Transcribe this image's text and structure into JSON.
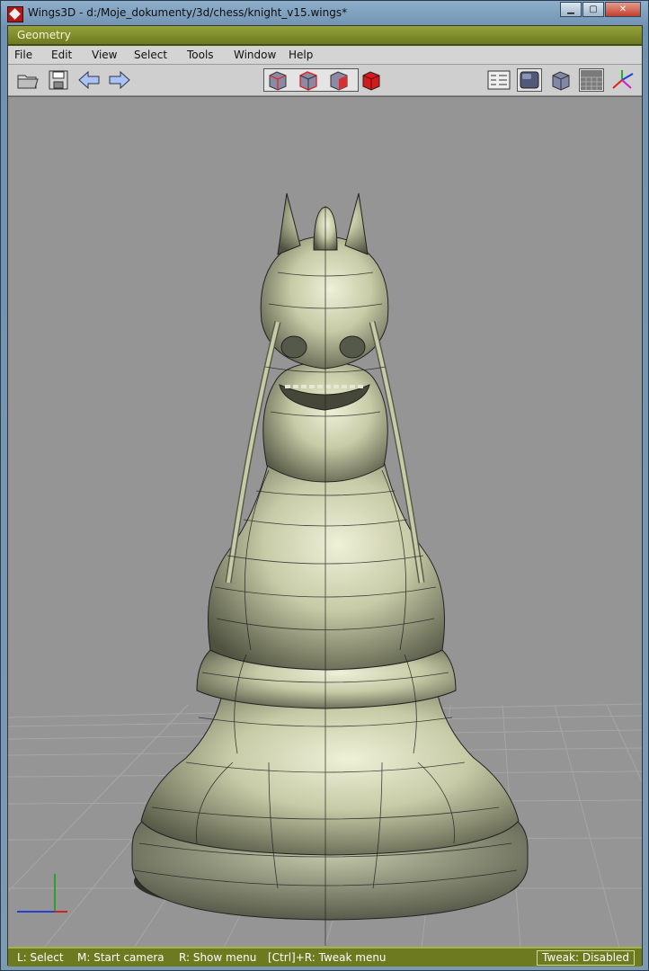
{
  "window": {
    "title": "Wings3D - d:/Moje_dokumenty/3d/chess/knight_v15.wings*",
    "controls": [
      "minimize",
      "maximize",
      "close"
    ]
  },
  "geometry_window": {
    "title": "Geometry"
  },
  "menubar": {
    "items": [
      "File",
      "Edit",
      "View",
      "Select",
      "Tools",
      "Window",
      "Help"
    ]
  },
  "toolbar": {
    "left": [
      "open-folder-icon",
      "save-disk-icon",
      "undo-arrow-icon",
      "redo-arrow-icon"
    ],
    "selection_modes": [
      "vertex-mode-icon",
      "edge-mode-icon",
      "face-mode-icon",
      "body-mode-icon"
    ],
    "right": [
      "outliner-icon",
      "smooth-shaded-icon",
      "wireframe-cube-icon",
      "ground-grid-icon",
      "axes-icon"
    ]
  },
  "viewport": {
    "scene": "chess knight model in wireframe over smooth shading",
    "background": "#959595",
    "model_color": "#c4c8a4"
  },
  "statusbar": {
    "hints": [
      "L: Select",
      "M: Start camera",
      "R: Show menu",
      "[Ctrl]+R: Tweak menu"
    ],
    "tweak": "Tweak: Disabled"
  },
  "colors": {
    "accent": "#6d7a1f",
    "title_accent": "#93a23a",
    "body_mode": "#cc2020",
    "viewport_bg": "#959595"
  }
}
